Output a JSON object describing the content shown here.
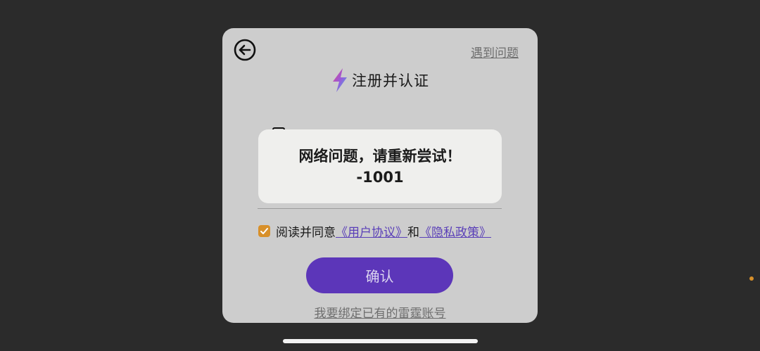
{
  "dialog": {
    "help_label": "遇到问题",
    "title": "注册并认证",
    "agreement": {
      "prefix": "阅读并同意",
      "user_agreement": "《用户协议》",
      "conjunction": "和",
      "privacy_policy": "《隐私政策》",
      "checked": true
    },
    "confirm_label": "确认",
    "bind_existing_label": "我要绑定已有的雷霆账号"
  },
  "toast": {
    "message": "网络问题，请重新尝试！",
    "code": "-1001"
  },
  "icons": {
    "back": "back-arrow-circle-icon",
    "logo": "lightning-bolt-logo-icon",
    "checkbox": "checkmark-icon"
  },
  "colors": {
    "background": "#2b2b2b",
    "dialog": "#cdcdcd",
    "accent": "#5c36b9",
    "checkbox": "#d8902a",
    "link": "#5a3fb8"
  }
}
